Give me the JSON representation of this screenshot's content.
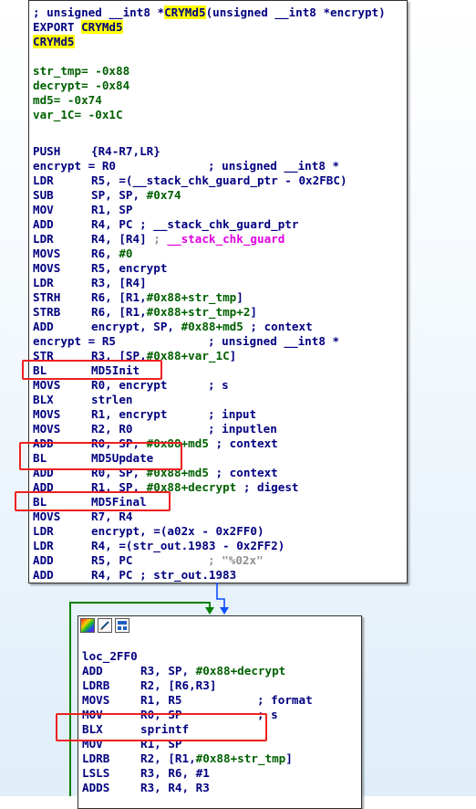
{
  "block1": {
    "header": {
      "line1": "; unsigned __int8 *CRYMd5(unsigned __int8 *encrypt)",
      "line1_pre": "; unsigned __int8 *",
      "line1_fn": "CRYMd5",
      "line1_post": "(unsigned __int8 *encrypt)",
      "export_kw": "EXPORT ",
      "export_name": "CRYMd5",
      "label": "CRYMd5"
    },
    "vars": [
      "str_tmp= -0x88",
      "decrypt= -0x84",
      "md5= -0x74",
      "var_1C= -0x1C"
    ],
    "code": [
      {
        "mn": "PUSH",
        "op": "{R4-R7,LR}",
        "cm": ""
      },
      {
        "mn": "encrypt = R0",
        "op": "",
        "cm": "; unsigned __int8 *"
      },
      {
        "mn": "LDR",
        "op": "R5, =(__stack_chk_guard_ptr - 0x2FBC)",
        "cm": ""
      },
      {
        "mn": "SUB",
        "op": "SP, SP, #0x74",
        "cm": ""
      },
      {
        "mn": "MOV",
        "op": "R1, SP",
        "cm": ""
      },
      {
        "mn": "ADD",
        "op": "R4, PC ; __stack_chk_guard_ptr",
        "cm": ""
      },
      {
        "mn": "LDR",
        "op": "R4, [R4] ; __stack_chk_guard",
        "cm": ""
      },
      {
        "mn": "MOVS",
        "op": "R6, #0",
        "cm": ""
      },
      {
        "mn": "MOVS",
        "op": "R5, encrypt",
        "cm": ""
      },
      {
        "mn": "LDR",
        "op": "R3, [R4]",
        "cm": ""
      },
      {
        "mn": "STRH",
        "op": "R6, [R1,#0x88+str_tmp]",
        "cm": ""
      },
      {
        "mn": "STRB",
        "op": "R6, [R1,#0x88+str_tmp+2]",
        "cm": ""
      },
      {
        "mn": "ADD",
        "op": "encrypt, SP, #0x88+md5 ; context",
        "cm": ""
      },
      {
        "mn": "encrypt = R5",
        "op": "",
        "cm": "; unsigned __int8 *"
      },
      {
        "mn": "STR",
        "op": "R3, [SP,#0x88+var_1C]",
        "cm": ""
      },
      {
        "mn": "BL",
        "op": "MD5Init",
        "cm": ""
      },
      {
        "mn": "MOVS",
        "op": "R0, encrypt",
        "cm": "; s"
      },
      {
        "mn": "BLX",
        "op": "strlen",
        "cm": ""
      },
      {
        "mn": "MOVS",
        "op": "R1, encrypt",
        "cm": "; input"
      },
      {
        "mn": "MOVS",
        "op": "R2, R0",
        "cm": "; inputlen"
      },
      {
        "mn": "ADD",
        "op": "R0, SP, #0x88+md5 ; context",
        "cm": ""
      },
      {
        "mn": "BL",
        "op": "MD5Update",
        "cm": ""
      },
      {
        "mn": "ADD",
        "op": "R0, SP, #0x88+md5 ; context",
        "cm": ""
      },
      {
        "mn": "ADD",
        "op": "R1, SP, #0x88+decrypt ; digest",
        "cm": ""
      },
      {
        "mn": "BL",
        "op": "MD5Final",
        "cm": ""
      },
      {
        "mn": "MOVS",
        "op": "R7, R4",
        "cm": ""
      },
      {
        "mn": "LDR",
        "op": "encrypt, =(a02x - 0x2FF0)",
        "cm": ""
      },
      {
        "mn": "LDR",
        "op": "R4, =(str_out.1983 - 0x2FF2)",
        "cm": ""
      },
      {
        "mn": "ADD",
        "op": "R5, PC",
        "cm": "; \"%02x\""
      },
      {
        "mn": "ADD",
        "op": "R4, PC ; str_out.1983",
        "cm": ""
      }
    ]
  },
  "block2": {
    "label": "loc_2FF0",
    "code": [
      {
        "mn": "ADD",
        "op": "R3, SP, #0x88+decrypt",
        "cm": ""
      },
      {
        "mn": "LDRB",
        "op": "R2, [R6,R3]",
        "cm": ""
      },
      {
        "mn": "MOVS",
        "op": "R1, R5",
        "cm": "; format"
      },
      {
        "mn": "MOV",
        "op": "R0, SP",
        "cm": "; s"
      },
      {
        "mn": "BLX",
        "op": "sprintf",
        "cm": ""
      },
      {
        "mn": "MOV",
        "op": "R1, SP",
        "cm": ""
      },
      {
        "mn": "LDRB",
        "op": "R2, [R1,#0x88+str_tmp]",
        "cm": ""
      },
      {
        "mn": "LSLS",
        "op": "R3, R6, #1",
        "cm": ""
      },
      {
        "mn": "ADDS",
        "op": "R3, R4, R3",
        "cm": ""
      }
    ]
  },
  "colors": {
    "highlight_box": "#ef2020",
    "edge_green": "#008000",
    "edge_blue": "#1050ff"
  },
  "icons": [
    "color-palette-icon",
    "edit-pencil-icon",
    "graph-view-icon"
  ]
}
